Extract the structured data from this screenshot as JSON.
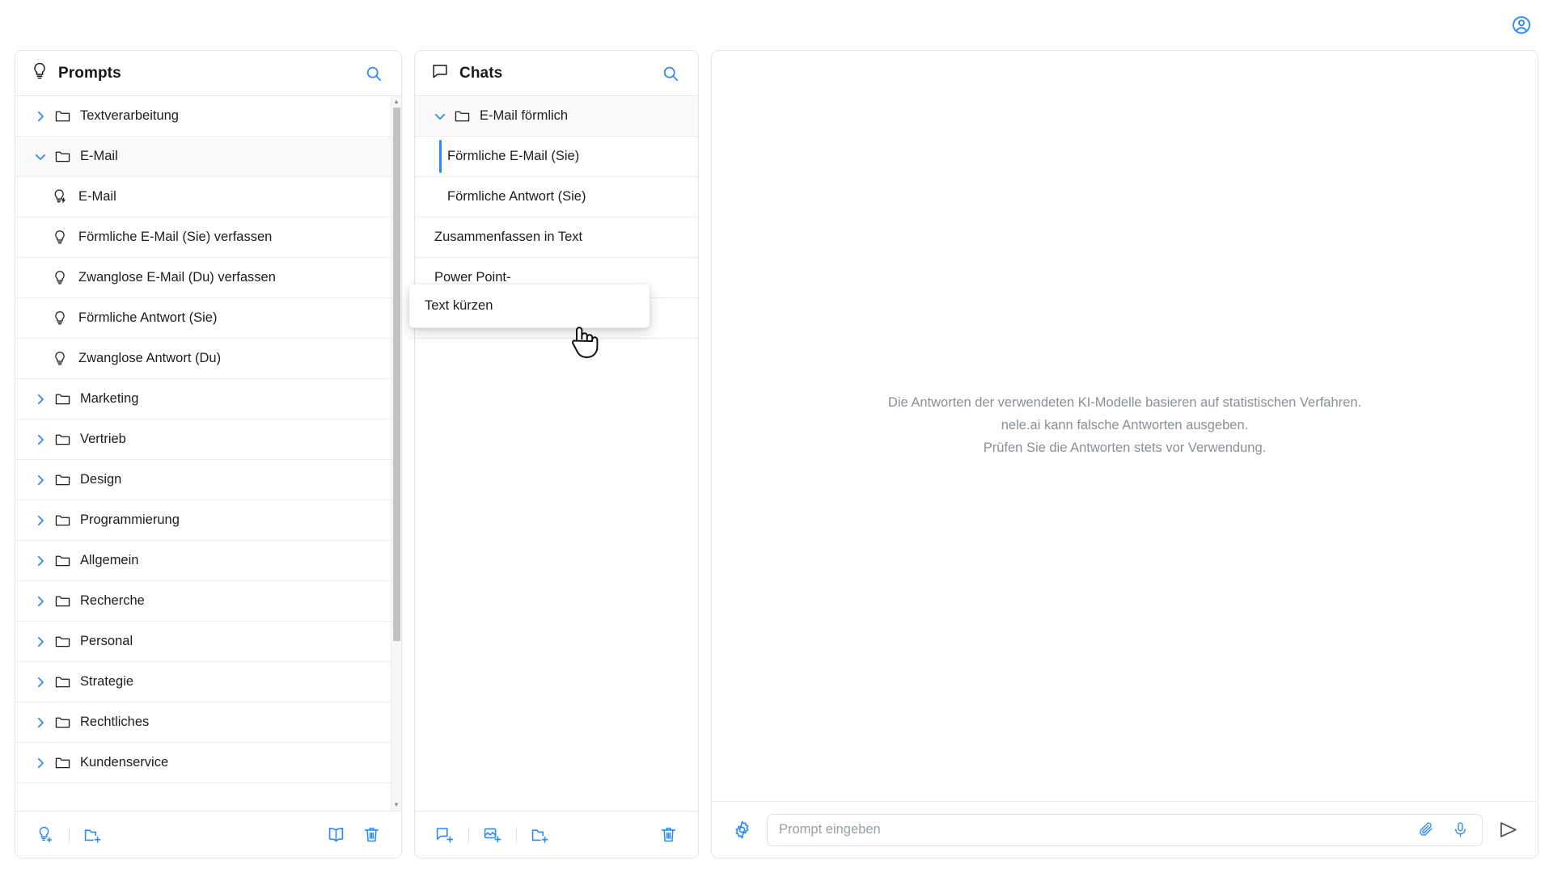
{
  "topbar": {
    "account_icon": "account-circle-icon"
  },
  "prompts": {
    "title": "Prompts",
    "header_icon": "lightbulb-icon",
    "search_icon": "search-icon",
    "items": [
      {
        "label": "Textverarbeitung",
        "type": "folder",
        "expanded": false
      },
      {
        "label": "E-Mail",
        "type": "folder",
        "expanded": true
      },
      {
        "label": "E-Mail",
        "type": "prompt-quick"
      },
      {
        "label": "Förmliche E-Mail (Sie) verfassen",
        "type": "prompt"
      },
      {
        "label": "Zwanglose E-Mail (Du) verfassen",
        "type": "prompt"
      },
      {
        "label": "Förmliche Antwort (Sie)",
        "type": "prompt"
      },
      {
        "label": "Zwanglose Antwort (Du)",
        "type": "prompt"
      },
      {
        "label": "Marketing",
        "type": "folder",
        "expanded": false
      },
      {
        "label": "Vertrieb",
        "type": "folder",
        "expanded": false
      },
      {
        "label": "Design",
        "type": "folder",
        "expanded": false
      },
      {
        "label": "Programmierung",
        "type": "folder",
        "expanded": false
      },
      {
        "label": "Allgemein",
        "type": "folder",
        "expanded": false
      },
      {
        "label": "Recherche",
        "type": "folder",
        "expanded": false
      },
      {
        "label": "Personal",
        "type": "folder",
        "expanded": false
      },
      {
        "label": "Strategie",
        "type": "folder",
        "expanded": false
      },
      {
        "label": "Rechtliches",
        "type": "folder",
        "expanded": false
      },
      {
        "label": "Kundenservice",
        "type": "folder",
        "expanded": false
      }
    ],
    "footer": {
      "add_prompt": "add-prompt-icon",
      "add_folder": "add-folder-icon",
      "library": "book-icon",
      "delete": "trash-icon"
    }
  },
  "chats": {
    "title": "Chats",
    "header_icon": "chat-bubble-icon",
    "search_icon": "search-icon",
    "items": [
      {
        "label": "E-Mail förmlich",
        "type": "folder",
        "expanded": true,
        "selected": false
      },
      {
        "label": "Förmliche E-Mail (Sie)",
        "type": "chat",
        "selected": true
      },
      {
        "label": "Förmliche Antwort (Sie)",
        "type": "chat",
        "selected": false
      },
      {
        "label": "Zusammenfassen in Text",
        "type": "chat-root",
        "selected": false
      },
      {
        "label": "Power Point-",
        "type": "chat-root",
        "selected": false
      },
      {
        "label": "Text kürzen",
        "type": "chat-root",
        "selected": false
      }
    ],
    "footer": {
      "new_chat": "new-chat-icon",
      "new_image_chat": "new-image-chat-icon",
      "new_folder": "add-folder-icon",
      "delete": "trash-icon"
    }
  },
  "main": {
    "disclaimer_lines": [
      "Die Antworten der verwendeten KI-Modelle basieren auf statistischen Verfahren.",
      "nele.ai kann falsche Antworten ausgeben.",
      "Prüfen Sie die Antworten stets vor Verwendung."
    ],
    "composer": {
      "settings_icon": "gear-icon",
      "placeholder": "Prompt eingeben",
      "value": "",
      "attach_icon": "paperclip-icon",
      "mic_icon": "microphone-icon",
      "send_icon": "send-icon"
    }
  },
  "drag": {
    "label": "Text kürzen",
    "cursor": "grabbing-hand-cursor"
  },
  "colors": {
    "accent": "#2b8af5",
    "text": "#1b1d21",
    "muted": "#8a8f98",
    "border": "#e6e8ea"
  }
}
